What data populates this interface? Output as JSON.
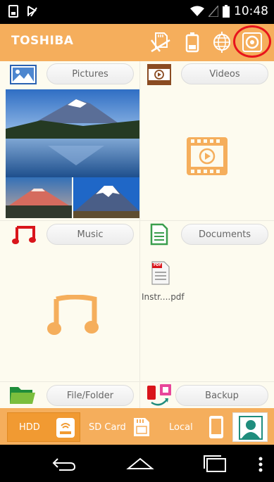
{
  "status_bar": {
    "time": "10:48"
  },
  "app_bar": {
    "brand": "TOSHIBA",
    "icons": [
      "sd-card-transfer-icon",
      "battery-icon",
      "network-globe-icon",
      "settings-icon"
    ]
  },
  "categories": {
    "pictures": {
      "label": "Pictures"
    },
    "videos": {
      "label": "Videos"
    },
    "music": {
      "label": "Music"
    },
    "documents": {
      "label": "Documents",
      "files": [
        {
          "name": "Instr....pdf",
          "type_badge": "PDF"
        }
      ]
    },
    "file_folder": {
      "label": "File/Folder"
    },
    "backup": {
      "label": "Backup"
    }
  },
  "bottom_tabs": [
    {
      "label": "HDD",
      "active": true
    },
    {
      "label": "SD Card",
      "active": false
    },
    {
      "label": "Local",
      "active": false
    }
  ],
  "colors": {
    "accent": "#f5ae5c",
    "accent_dark": "#f19a32",
    "panel_bg": "#fdfbef",
    "highlight_ring": "#e8141c",
    "music_red": "#d9151b",
    "doc_green": "#3a9e4d",
    "teal": "#1f8d7d"
  }
}
